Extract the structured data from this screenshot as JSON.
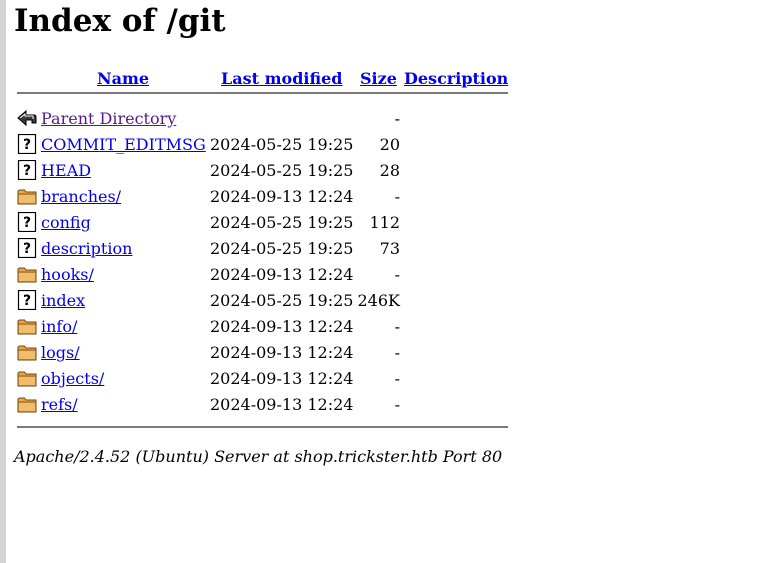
{
  "page": {
    "title": "Index of /git"
  },
  "columns": {
    "name": "Name",
    "last_modified": "Last modified",
    "size": "Size",
    "description": "Description"
  },
  "entries": [
    {
      "name": "Parent Directory",
      "date": "",
      "size": "-",
      "icon": "back-icon",
      "visited": true
    },
    {
      "name": "COMMIT_EDITMSG",
      "date": "2024-05-25 19:25",
      "size": "20",
      "icon": "unknown-file-icon"
    },
    {
      "name": "HEAD",
      "date": "2024-05-25 19:25",
      "size": "28",
      "icon": "unknown-file-icon"
    },
    {
      "name": "branches/",
      "date": "2024-09-13 12:24",
      "size": "-",
      "icon": "folder-icon"
    },
    {
      "name": "config",
      "date": "2024-05-25 19:25",
      "size": "112",
      "icon": "unknown-file-icon"
    },
    {
      "name": "description",
      "date": "2024-05-25 19:25",
      "size": "73",
      "icon": "unknown-file-icon"
    },
    {
      "name": "hooks/",
      "date": "2024-09-13 12:24",
      "size": "-",
      "icon": "folder-icon"
    },
    {
      "name": "index",
      "date": "2024-05-25 19:25",
      "size": "246K",
      "icon": "unknown-file-icon"
    },
    {
      "name": "info/",
      "date": "2024-09-13 12:24",
      "size": "-",
      "icon": "folder-icon"
    },
    {
      "name": "logs/",
      "date": "2024-09-13 12:24",
      "size": "-",
      "icon": "folder-icon"
    },
    {
      "name": "objects/",
      "date": "2024-09-13 12:24",
      "size": "-",
      "icon": "folder-icon"
    },
    {
      "name": "refs/",
      "date": "2024-09-13 12:24",
      "size": "-",
      "icon": "folder-icon"
    }
  ],
  "footer": {
    "address": "Apache/2.4.52 (Ubuntu) Server at shop.trickster.htb Port 80"
  },
  "colors": {
    "link": "#0000ee",
    "visited": "#551a8b",
    "folder": "#e8a54a",
    "rule": "#7a7a7a"
  }
}
